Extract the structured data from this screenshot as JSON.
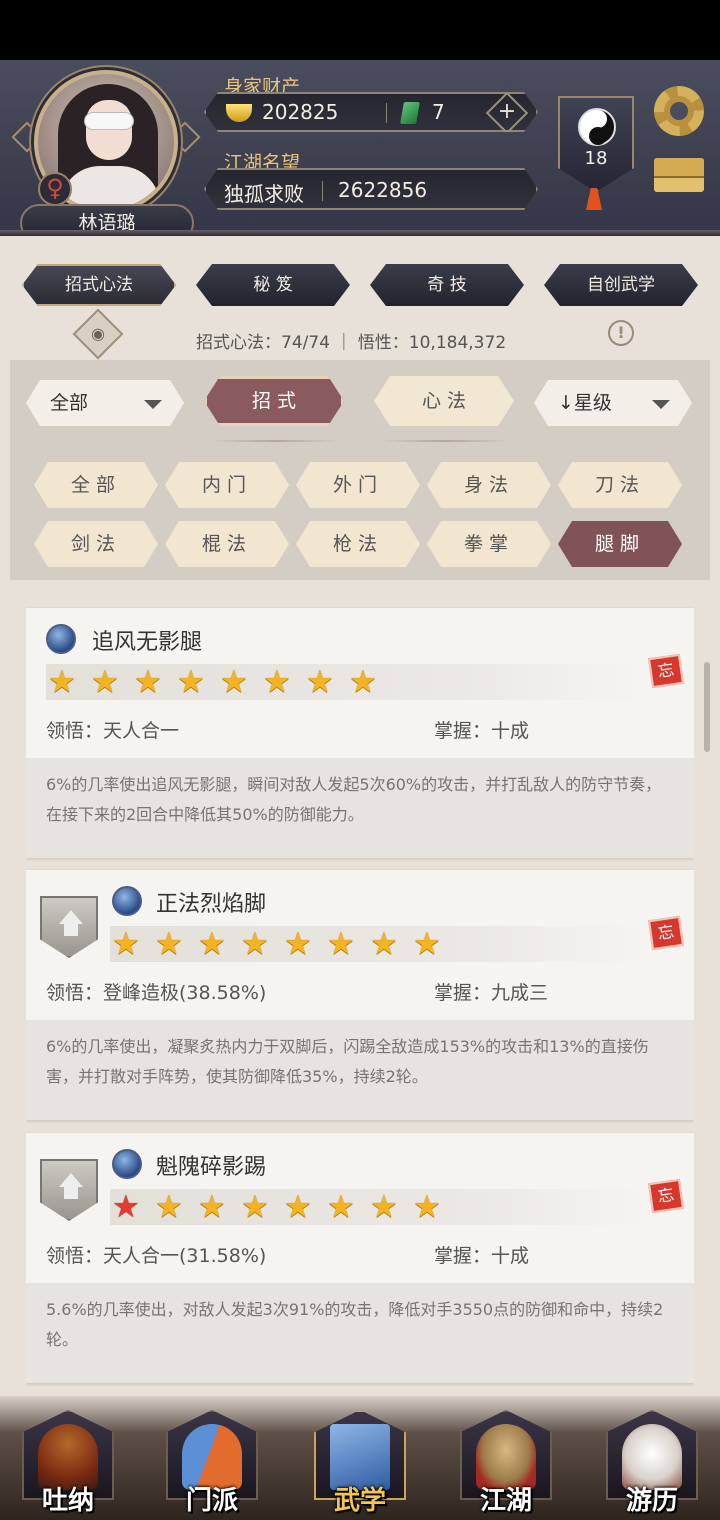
{
  "header": {
    "wealth_label": "身家财产",
    "gold": "202825",
    "jade": "7",
    "plus": "+",
    "fame_label": "江湖名望",
    "title": "独孤求败",
    "fame_value": "2622856",
    "player_name": "林语璐",
    "gender_symbol": "♀",
    "level": "18"
  },
  "tabs": [
    {
      "label": "招式心法"
    },
    {
      "label": "秘 笈"
    },
    {
      "label": "奇 技"
    },
    {
      "label": "自创武学"
    }
  ],
  "summary": "招式心法：74/74 ｜ 悟性：10,184,372",
  "filters": {
    "category_dropdown": "全部",
    "seg_moves": "招 式",
    "seg_mind": "心 法",
    "sort_dropdown": "↓星级",
    "chips": [
      "全部",
      "内门",
      "外门",
      "身法",
      "刀法",
      "剑法",
      "棍法",
      "枪法",
      "拳掌",
      "腿脚"
    ]
  },
  "skills": [
    {
      "name": "追风无影腿",
      "stars": 8,
      "red_stars": 0,
      "comprehension_label": "领悟：",
      "comprehension": "天人合一",
      "mastery_label": "掌握：",
      "mastery": "十成",
      "description": "6%的几率使出追风无影腿，瞬间对敌人发起5次60%的攻击，并打乱敌人的防守节奏，在接下来的2回合中降低其50%的防御能力。",
      "forget": "忘"
    },
    {
      "name": "正法烈焰脚",
      "stars": 8,
      "red_stars": 0,
      "comprehension_label": "领悟：",
      "comprehension": "登峰造极(38.58%)",
      "mastery_label": "掌握：",
      "mastery": "九成三",
      "description": "6%的几率使出，凝聚炙热内力于双脚后，闪踢全敌造成153%的攻击和13%的直接伤害，并打散对手阵势，使其防御降低35%，持续2轮。",
      "forget": "忘"
    },
    {
      "name": "魁隗碎影踢",
      "stars": 8,
      "red_stars": 1,
      "comprehension_label": "领悟：",
      "comprehension": "天人合一(31.58%)",
      "mastery_label": "掌握：",
      "mastery": "十成",
      "description": "5.6%的几率使出，对敌人发起3次91%的攻击，降低对手3550点的防御和命中，持续2轮。",
      "forget": "忘"
    }
  ],
  "bottom_nav": [
    {
      "label": "吐纳"
    },
    {
      "label": "门派"
    },
    {
      "label": "武学"
    },
    {
      "label": "江湖"
    },
    {
      "label": "游历"
    }
  ],
  "icons": {
    "settings": "gear-icon",
    "mail": "envelope-icon",
    "eye": "eye-icon",
    "info": "info-icon",
    "star": "star-icon",
    "forget": "forget-stamp-icon",
    "upgrade": "upgrade-arrow-icon"
  },
  "colors": {
    "header_bg": "#3b3d4c",
    "accent_gold": "#e8c47b",
    "active_chip": "#7f5358",
    "star": "#f4b321",
    "red_star": "#e33a31"
  }
}
